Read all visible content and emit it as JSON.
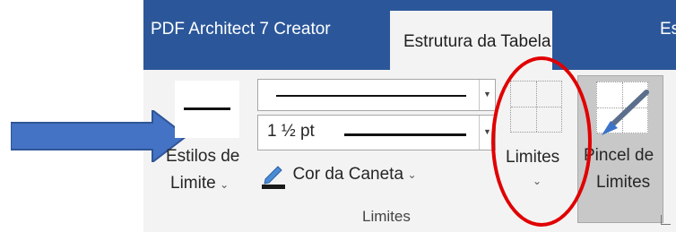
{
  "tabs": [
    {
      "label": "PDF Architect 7 Creator",
      "active": false
    },
    {
      "label": "Estrutura da Tabela",
      "active": true
    },
    {
      "label": "Esc",
      "active": false
    }
  ],
  "border_styles": {
    "label_line1": "Estilos de",
    "label_line2": "Limite",
    "caret": "⌄"
  },
  "line_style_select": {
    "value": "solid line"
  },
  "line_weight_select": {
    "value": "1 ½ pt"
  },
  "pen_color": {
    "label": "Cor da Caneta",
    "caret": "⌄",
    "color": "#1a1a1a"
  },
  "limites_button": {
    "label": "Limites",
    "caret": "⌄"
  },
  "pincel_button": {
    "label_line1": "Pincel de",
    "label_line2": "Limites"
  },
  "group_label": "Limites",
  "launcher_icon": "dialog-launcher-icon",
  "colors": {
    "tabbar": "#2b579a",
    "ribbon": "#f3f3f3",
    "annotation_arrow": "#4472c4",
    "annotation_ellipse": "#e10000"
  }
}
